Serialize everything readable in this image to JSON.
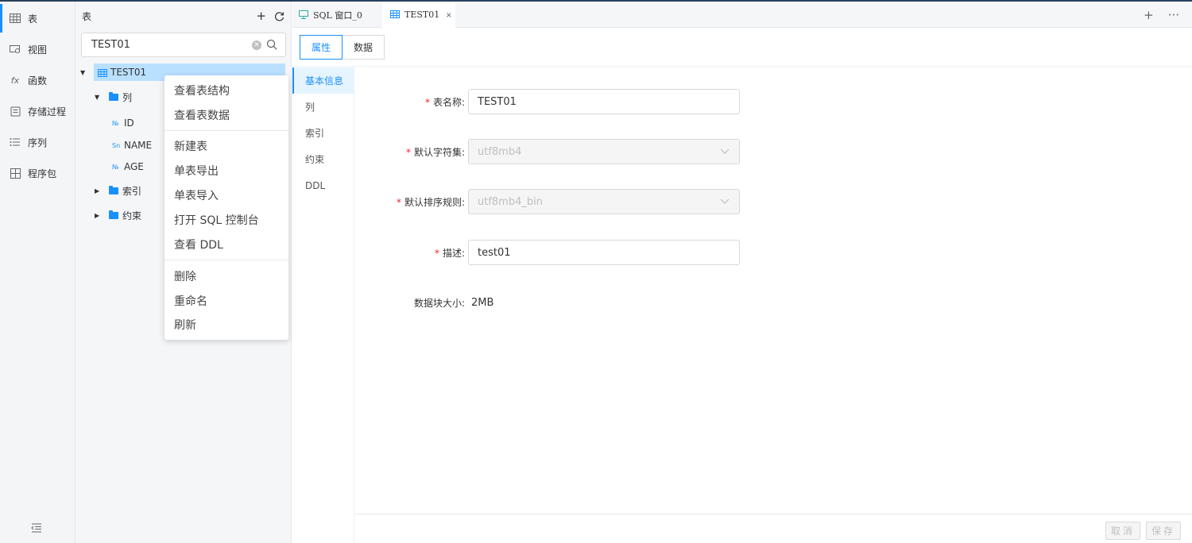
{
  "nav": {
    "items": [
      {
        "label": "表",
        "icon": "table-icon"
      },
      {
        "label": "视图",
        "icon": "view-icon"
      },
      {
        "label": "函数",
        "icon": "function-icon"
      },
      {
        "label": "存储过程",
        "icon": "procedure-icon"
      },
      {
        "label": "序列",
        "icon": "sequence-icon"
      },
      {
        "label": "程序包",
        "icon": "package-icon"
      }
    ],
    "fx": "fx"
  },
  "tree": {
    "title": "表",
    "search_value": "TEST01",
    "nodes": {
      "table": "TEST01",
      "columns_folder": "列",
      "col_type_num": "№",
      "col_type_str": "Sn",
      "col_id": "ID",
      "col_name": "NAME",
      "col_age": "AGE",
      "index_folder": "索引",
      "constraint_folder": "约束"
    }
  },
  "context_menu": {
    "items": [
      "查看表结构",
      "查看表数据",
      "新建表",
      "单表导出",
      "单表导入",
      "打开 SQL 控制台",
      "查看 DDL",
      "删除",
      "重命名",
      "刷新"
    ]
  },
  "tabs": [
    {
      "label": "SQL 窗口_0"
    },
    {
      "label": "TEST01",
      "close": "×"
    }
  ],
  "tab_actions": {
    "add": "+",
    "more": "···"
  },
  "subtabs": [
    "属性",
    "数据"
  ],
  "prop_nav": [
    "基本信息",
    "列",
    "索引",
    "约束",
    "DDL"
  ],
  "form": {
    "required_mark": "*",
    "table_name_label": "表名称:",
    "table_name_value": "TEST01",
    "charset_label": "默认字符集:",
    "charset_value": "utf8mb4",
    "collation_label": "默认排序规则:",
    "collation_value": "utf8mb4_bin",
    "desc_label": "描述:",
    "desc_value": "test01",
    "block_size_label": "数据块大小:",
    "block_size_value": "2MB"
  },
  "footer": {
    "cancel": "取消",
    "save": "保存"
  },
  "colors": {
    "accent": "#1890ff",
    "required": "#f5222d",
    "selected_node": "#bae0ff"
  }
}
